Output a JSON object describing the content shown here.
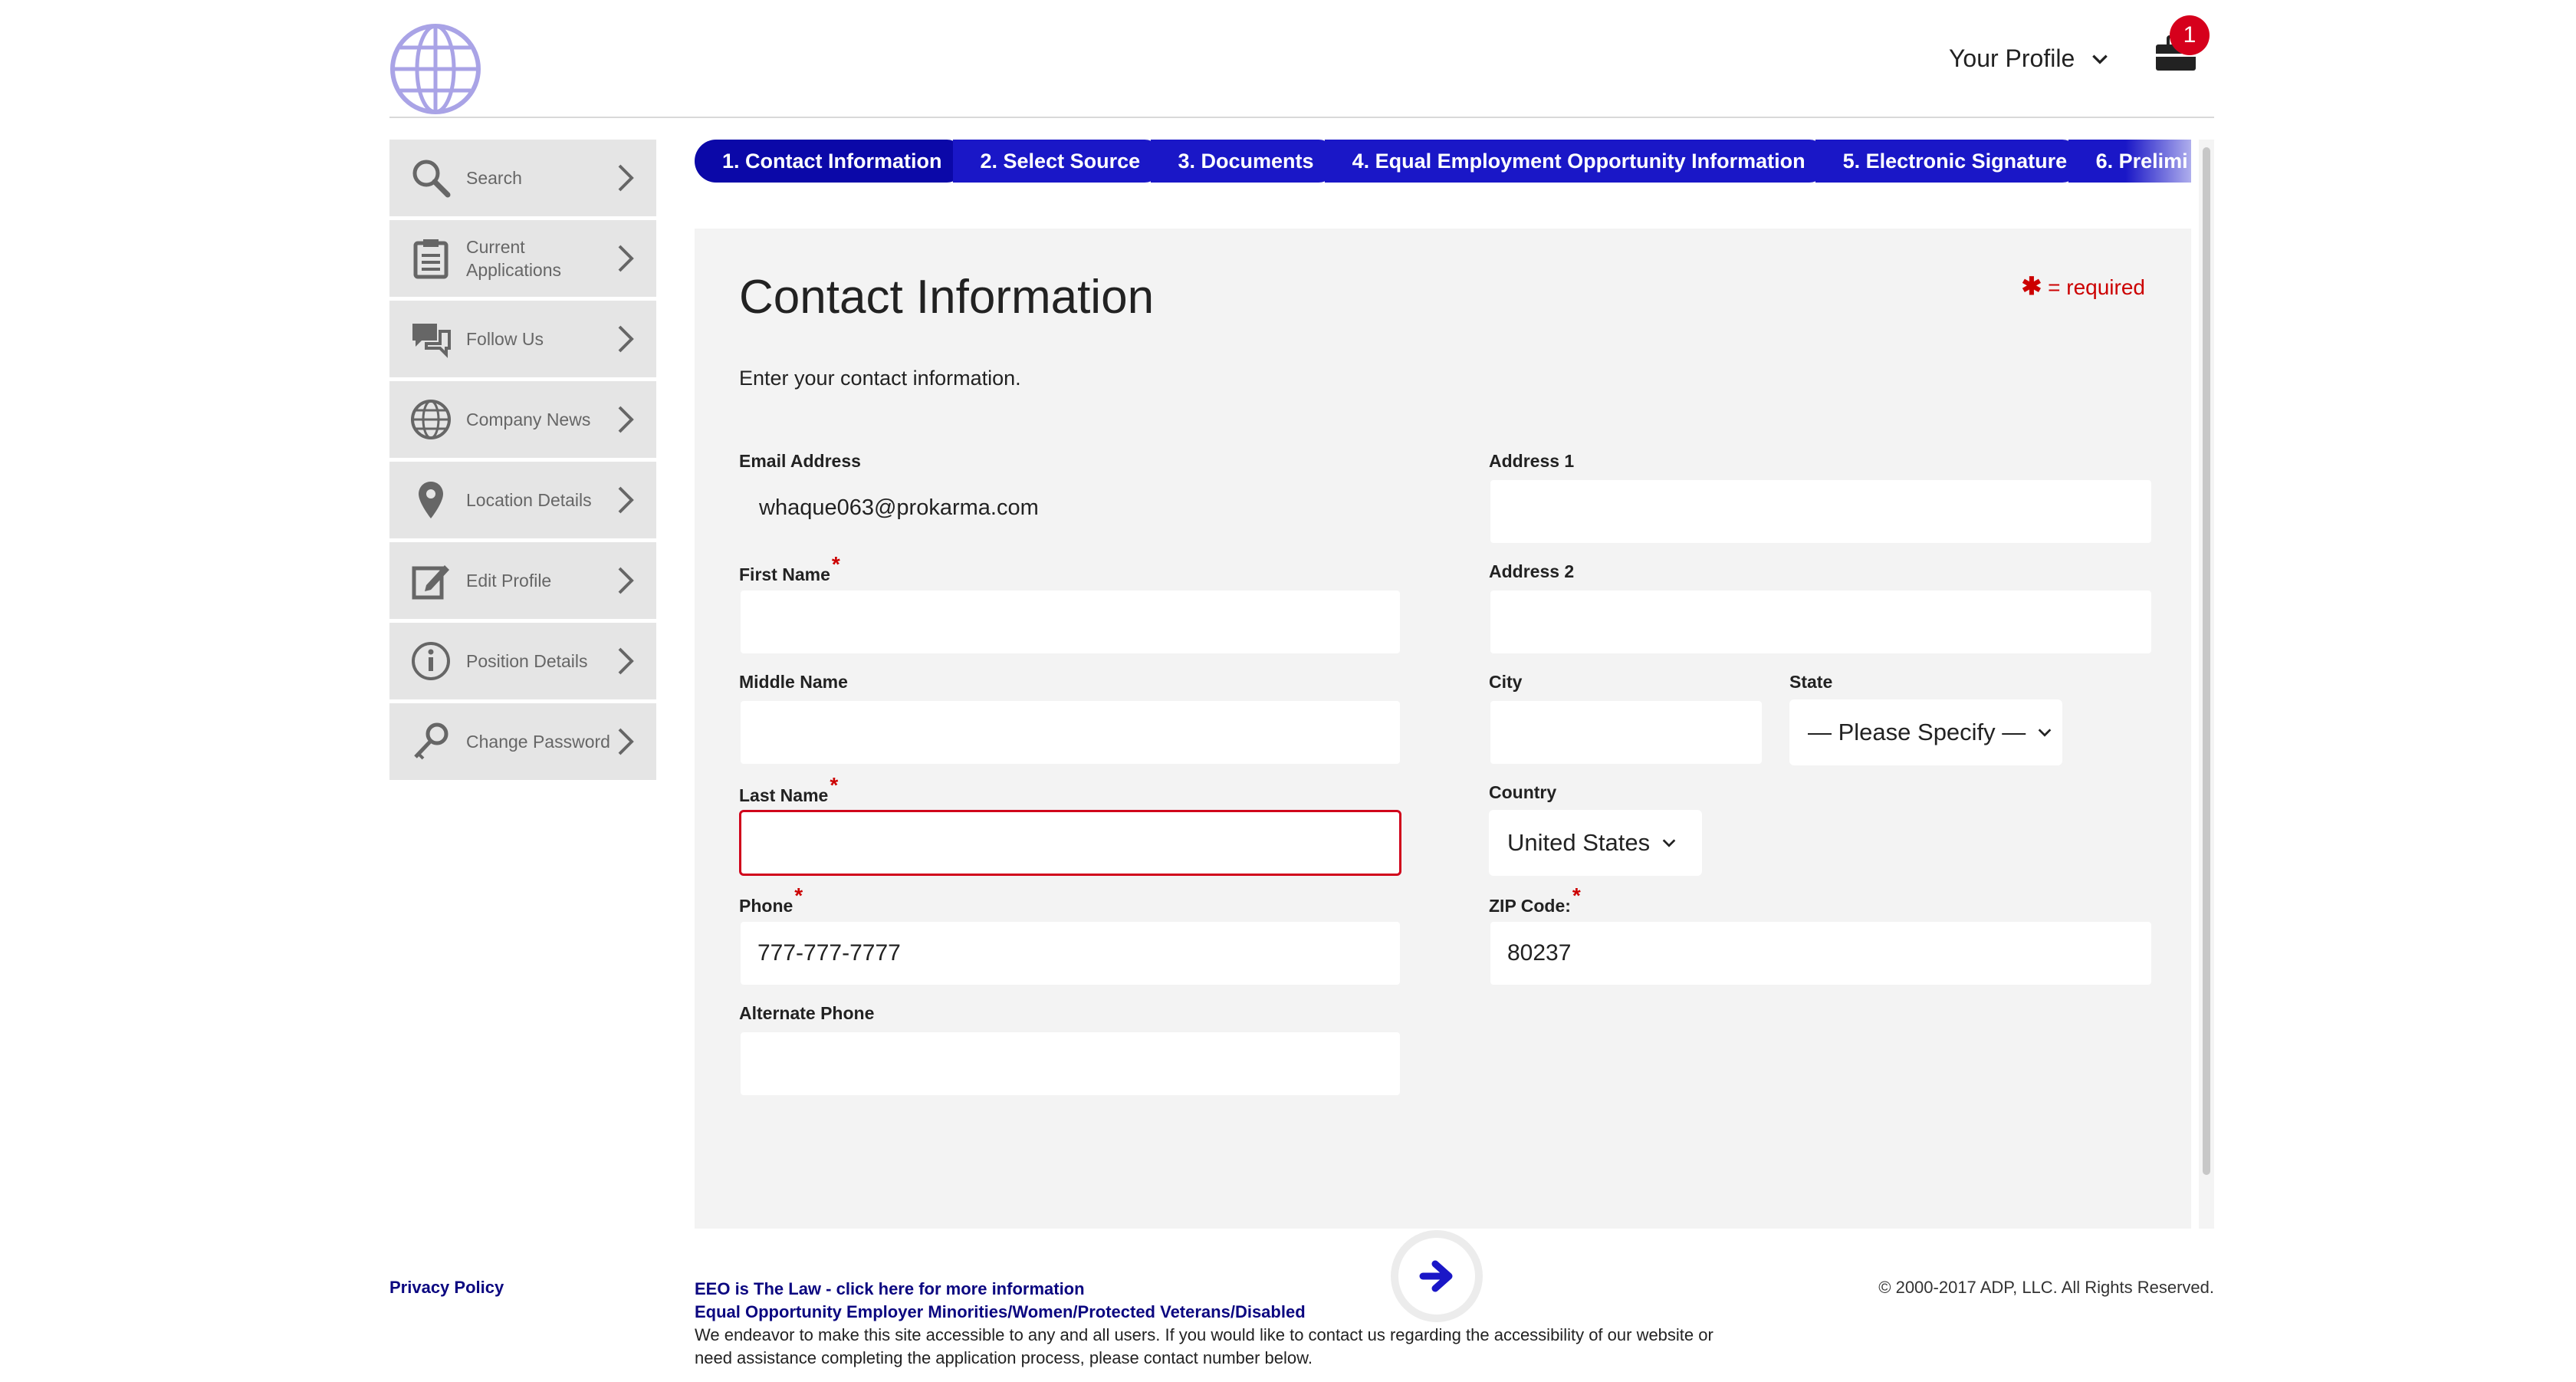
{
  "header": {
    "profile_label": "Your Profile",
    "notification_count": "1"
  },
  "sidebar": {
    "items": [
      {
        "label": "Search",
        "icon": "search-icon"
      },
      {
        "label": "Current Applications",
        "icon": "clipboard-icon"
      },
      {
        "label": "Follow Us",
        "icon": "chat-bubbles-icon"
      },
      {
        "label": "Company News",
        "icon": "globe-icon"
      },
      {
        "label": "Location Details",
        "icon": "map-pin-icon"
      },
      {
        "label": "Edit Profile",
        "icon": "edit-icon"
      },
      {
        "label": "Position Details",
        "icon": "info-icon"
      },
      {
        "label": "Change Password",
        "icon": "key-icon"
      }
    ]
  },
  "steps": [
    "1. Contact Information",
    "2. Select Source",
    "3. Documents",
    "4. Equal Employment Opportunity Information",
    "5. Electronic Signature",
    "6. Prelimi"
  ],
  "form": {
    "title": "Contact Information",
    "required_note": "= required",
    "intro": "Enter your contact information.",
    "email_label": "Email Address",
    "email_value": "whaque063@prokarma.com",
    "first_name_label": "First Name",
    "first_name_value": "",
    "middle_name_label": "Middle Name",
    "middle_name_value": "",
    "last_name_label": "Last Name",
    "last_name_value": "",
    "phone_label": "Phone",
    "phone_value": "777-777-7777",
    "alt_phone_label": "Alternate Phone",
    "alt_phone_value": "",
    "address1_label": "Address 1",
    "address1_value": "",
    "address2_label": "Address 2",
    "address2_value": "",
    "city_label": "City",
    "city_value": "",
    "state_label": "State",
    "state_value": "— Please Specify —",
    "country_label": "Country",
    "country_value": "United States",
    "zip_label": "ZIP Code:",
    "zip_value": "80237"
  },
  "footer": {
    "privacy": "Privacy Policy",
    "eeo_link": "EEO is The Law - click here for more information",
    "eeo_employer": "Equal Opportunity Employer Minorities/Women/Protected Veterans/Disabled",
    "accessibility": "We endeavor to make this site accessible to any and all users. If you would like to contact us regarding the accessibility of our website or need assistance completing the application process, please contact number below.",
    "copyright": "© 2000-2017 ADP, LLC. All Rights Reserved."
  },
  "colors": {
    "accent": "#1a17c7",
    "error": "#d0021b",
    "required": "#cc0000",
    "link": "#0b0780"
  }
}
